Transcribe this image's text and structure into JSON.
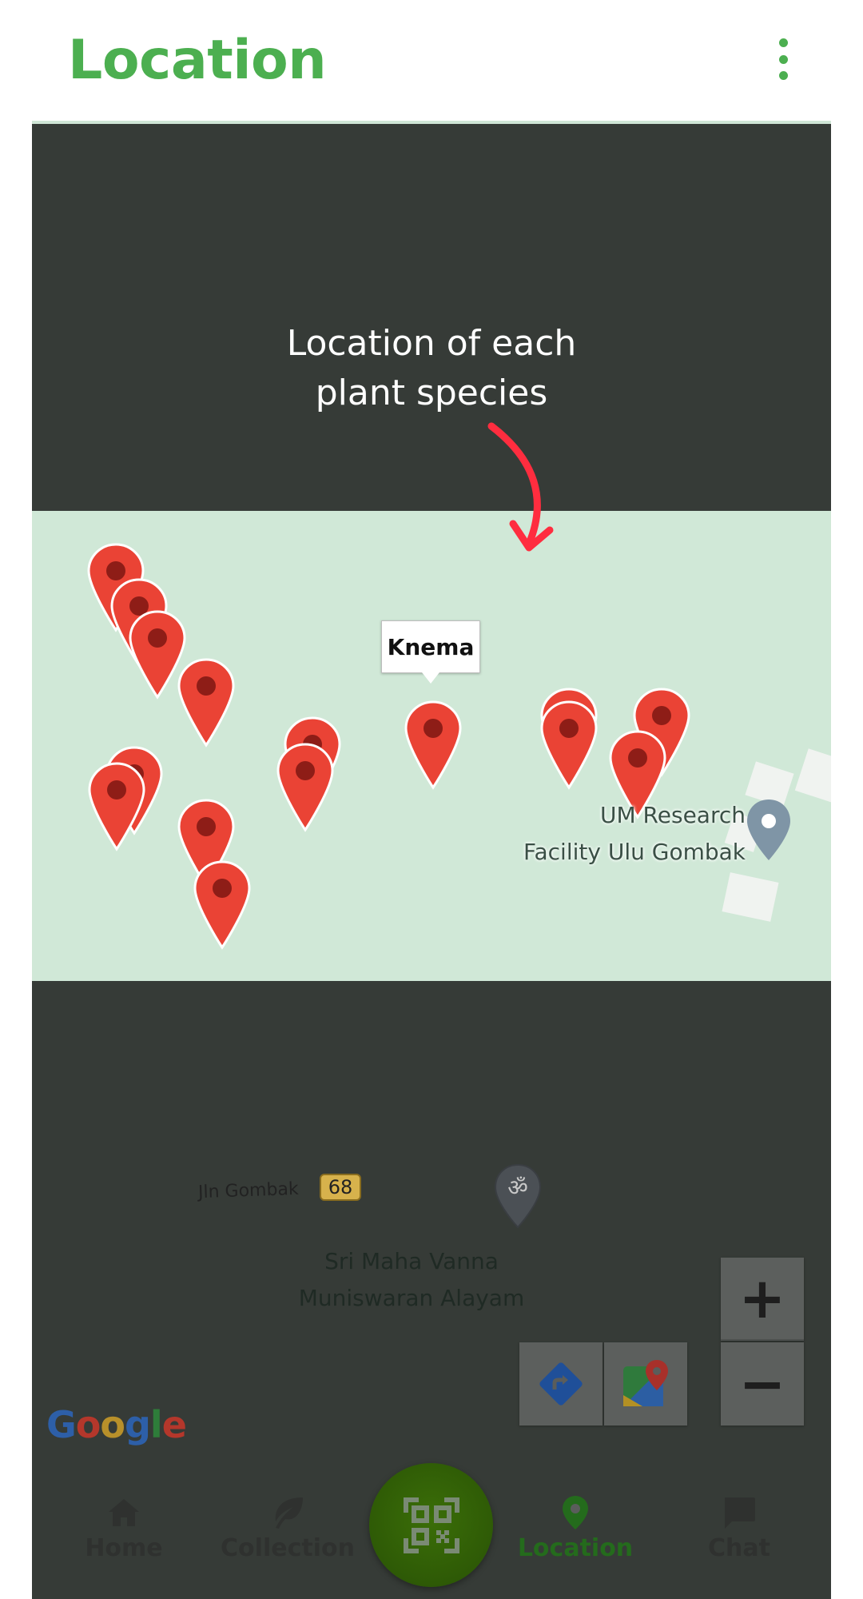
{
  "appbar": {
    "title": "Location",
    "menu_icon": "more-vert-icon"
  },
  "annotation": {
    "line1": "Location of each",
    "line2": "plant species",
    "arrow_color": "#ff2d3f"
  },
  "map": {
    "callout_label": "Knema",
    "poi": {
      "line1": "UM Research",
      "line2": "Facility Ulu Gombak"
    },
    "road": {
      "name": "Jln Gombak",
      "route_number": "68"
    },
    "temple": {
      "line1": "Sri Maha Vanna",
      "line2": "Muniswaran Alayam"
    },
    "zoom_in_label": "+",
    "zoom_out_label": "−",
    "directions_icon": "directions-icon",
    "google_maps_icon": "google-maps-icon",
    "pin_color": "#ea4335",
    "logo": [
      "G",
      "o",
      "o",
      "g",
      "l",
      "e"
    ]
  },
  "bottom_nav": {
    "items": [
      {
        "label": "Home",
        "icon": "home-icon"
      },
      {
        "label": "Collection",
        "icon": "leaf-icon"
      },
      {
        "label": "Location",
        "icon": "location-pin-icon",
        "active": true
      },
      {
        "label": "Chat",
        "icon": "chat-icon"
      }
    ],
    "scan_icon": "qr-scan-icon"
  },
  "colors": {
    "accent": "#4caf50",
    "active_nav": "#246b1c"
  }
}
